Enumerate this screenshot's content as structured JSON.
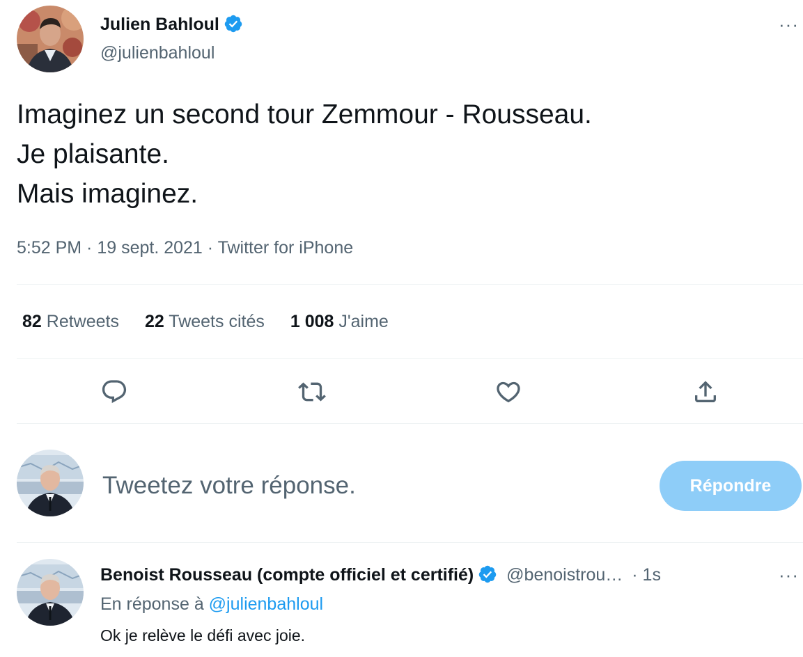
{
  "tweet": {
    "author_name": "Julien Bahloul",
    "author_handle": "@julienbahloul",
    "lines": [
      "Imaginez un second tour Zemmour - Rousseau.",
      "Je plaisante.",
      "Mais imaginez."
    ],
    "timestamp": "5:52 PM · 19 sept. 2021 · Twitter for iPhone",
    "more_label": "···"
  },
  "stats": {
    "retweets_count": "82",
    "retweets_label": "Retweets",
    "quotes_count": "22",
    "quotes_label": "Tweets cités",
    "likes_count": "1 008",
    "likes_label": "J'aime"
  },
  "actions": {
    "reply_icon": "reply-icon",
    "retweet_icon": "retweet-icon",
    "like_icon": "heart-icon",
    "share_icon": "share-icon"
  },
  "composer": {
    "placeholder": "Tweetez votre réponse.",
    "button_label": "Répondre"
  },
  "reply": {
    "author_name": "Benoist Rousseau (compte officiel et certifié)",
    "author_handle": "@benoistrou…",
    "time": "· 1s",
    "in_reply_prefix": "En réponse à",
    "in_reply_handle": "@julienbahloul",
    "text": "Ok je relève le défi avec joie.",
    "more_label": "···"
  },
  "colors": {
    "accent": "#1d9bf0",
    "button_disabled": "#8ecdf8",
    "secondary_text": "#536471",
    "divider": "#eff3f4"
  }
}
